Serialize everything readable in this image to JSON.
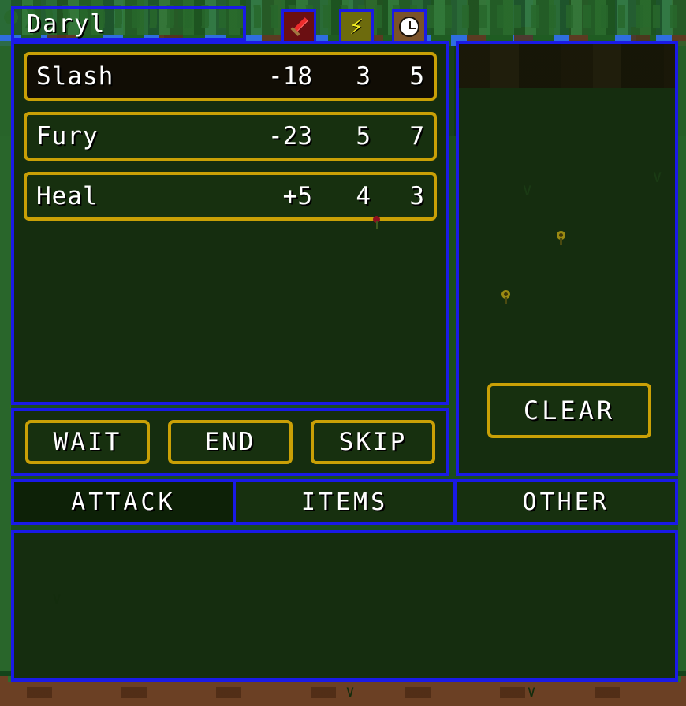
{
  "character": {
    "name": "Daryl"
  },
  "status_icons": [
    {
      "id": "weapon",
      "icon": "sword-icon",
      "color": "#6b0f12"
    },
    {
      "id": "speed",
      "icon": "lightning-bolt-icon",
      "glyph": "⚡",
      "color": "#6d6b0d"
    },
    {
      "id": "time",
      "icon": "clock-icon",
      "color": "#7a5229"
    }
  ],
  "skills": [
    {
      "name": "Slash",
      "effect": "-18",
      "col2": "3",
      "col3": "5",
      "selected": true
    },
    {
      "name": "Fury",
      "effect": "-23",
      "col2": "5",
      "col3": "7",
      "selected": false
    },
    {
      "name": "Heal",
      "effect": "+5",
      "col2": "4",
      "col3": "3",
      "selected": false
    }
  ],
  "actions": [
    {
      "label": "WAIT"
    },
    {
      "label": "END"
    },
    {
      "label": "SKIP"
    }
  ],
  "target_panel": {
    "clear_label": "CLEAR"
  },
  "tabs": [
    {
      "label": "ATTACK",
      "active": true
    },
    {
      "label": "ITEMS",
      "active": false
    },
    {
      "label": "OTHER",
      "active": false
    }
  ],
  "message_log": {
    "text": ""
  },
  "colors": {
    "frame_blue": "#1a1ae6",
    "frame_gold": "#c9a006",
    "panel_bg": "#152d0f",
    "panel_bg_dark": "#0d2107",
    "text": "#ffffff"
  }
}
